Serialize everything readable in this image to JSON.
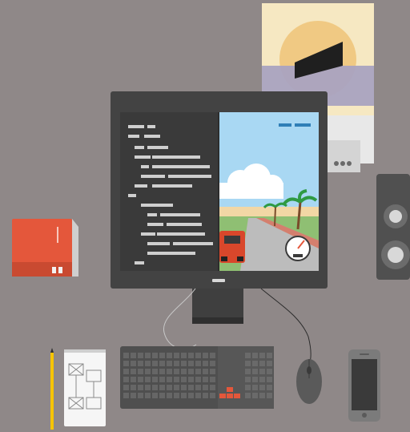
{
  "scene": {
    "background_color": "#8f8888",
    "items": [
      "poster-artwork",
      "desktop-monitor",
      "code-editor-panel",
      "racing-game-panel",
      "speaker",
      "red-book",
      "sketch-notepad",
      "pencil",
      "keyboard",
      "mouse",
      "smartphone"
    ]
  },
  "monitor": {
    "bezel_color": "#434343",
    "screen_split": {
      "left": "code-editor",
      "right": "racing-game"
    }
  },
  "code_editor": {
    "background_color": "#3a3a3a",
    "line_color": "#cfcfcf"
  },
  "game": {
    "sky_color": "#a9d8f3",
    "road_color": "#bcbcbc",
    "car_color": "#d9472b",
    "score_bars_color": "#2f7fb7"
  },
  "poster": {
    "colors": [
      "#f6e8c2",
      "#f0c983",
      "#a9a3c0",
      "#1f1f1f"
    ]
  },
  "book": {
    "cover_color": "#e4573b"
  },
  "keyboard": {
    "color": "#4f4f4f",
    "arrow_keys_color": "#e4573b"
  },
  "icons": {
    "speedometer": "speedometer-icon",
    "palm_tree": "palm-tree-icon",
    "cloud": "cloud-icon"
  }
}
